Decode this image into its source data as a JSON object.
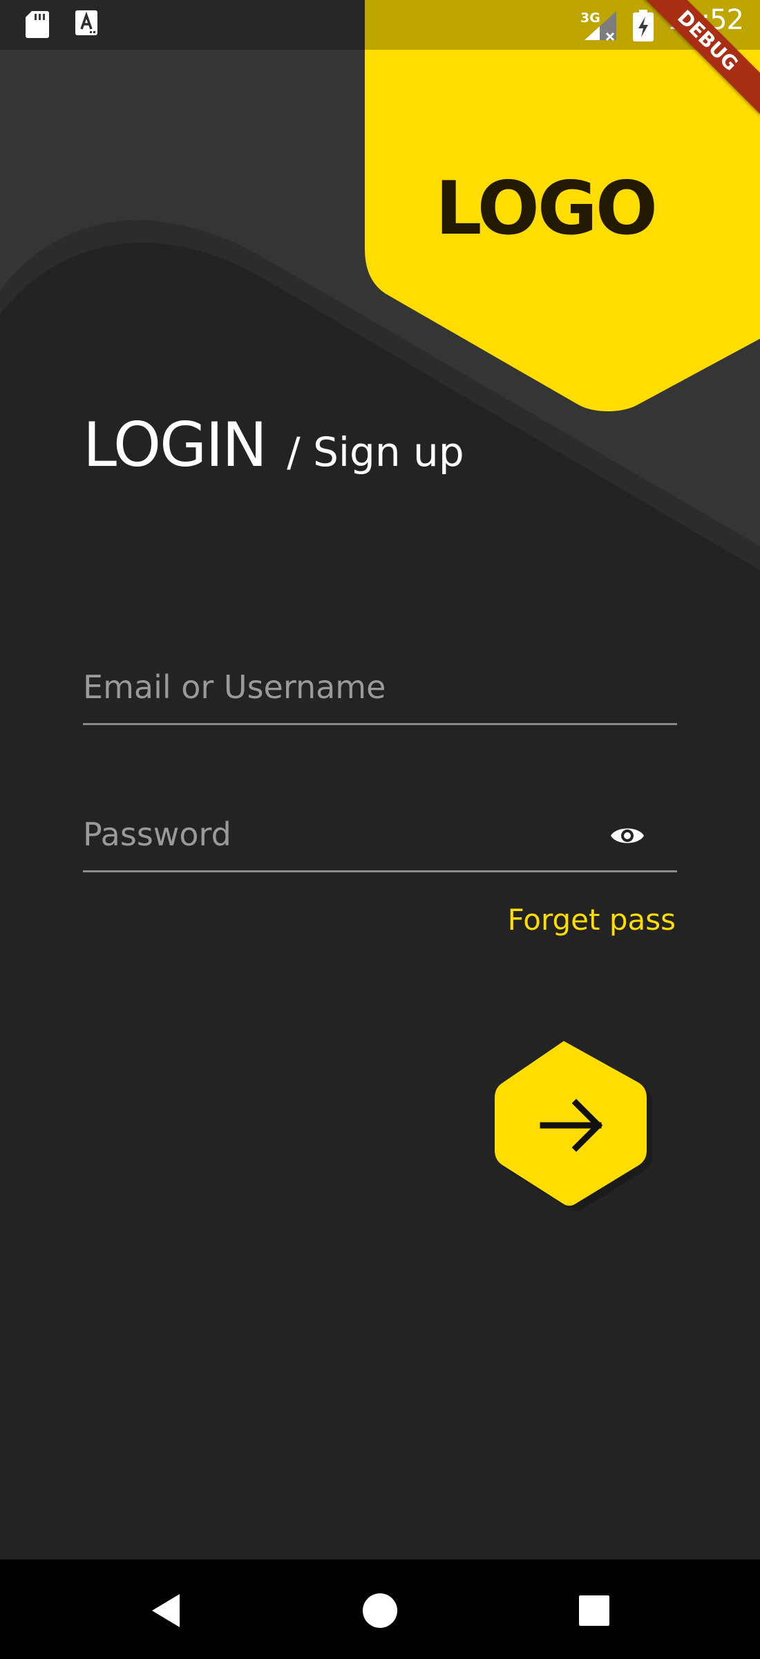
{
  "status_bar": {
    "time": "12:52",
    "network": "3G",
    "left_icons": [
      "sd-card-icon",
      "text-a-icon"
    ],
    "right_icons": [
      "network-3g-icon",
      "battery-charging-icon"
    ]
  },
  "debug_banner": "DEBUG",
  "logo": {
    "text": "LOGO"
  },
  "header": {
    "title": "LOGIN",
    "subtitle": "/ Sign up"
  },
  "form": {
    "email": {
      "placeholder": "Email or Username",
      "value": ""
    },
    "password": {
      "placeholder": "Password",
      "value": "",
      "toggle_icon": "eye-icon"
    },
    "forget_pass": "Forget pass",
    "submit_icon": "arrow-right-icon"
  },
  "nav_bar": {
    "icons": [
      "back-icon",
      "home-icon",
      "recents-icon"
    ]
  },
  "colors": {
    "accent": "#ffdd00",
    "background": "#232323",
    "background_light": "#353535",
    "logo_text": "#211a00",
    "debug_ribbon": "#a82e14",
    "field_underline": "#8a8a8a",
    "placeholder": "#9a9a9a"
  }
}
